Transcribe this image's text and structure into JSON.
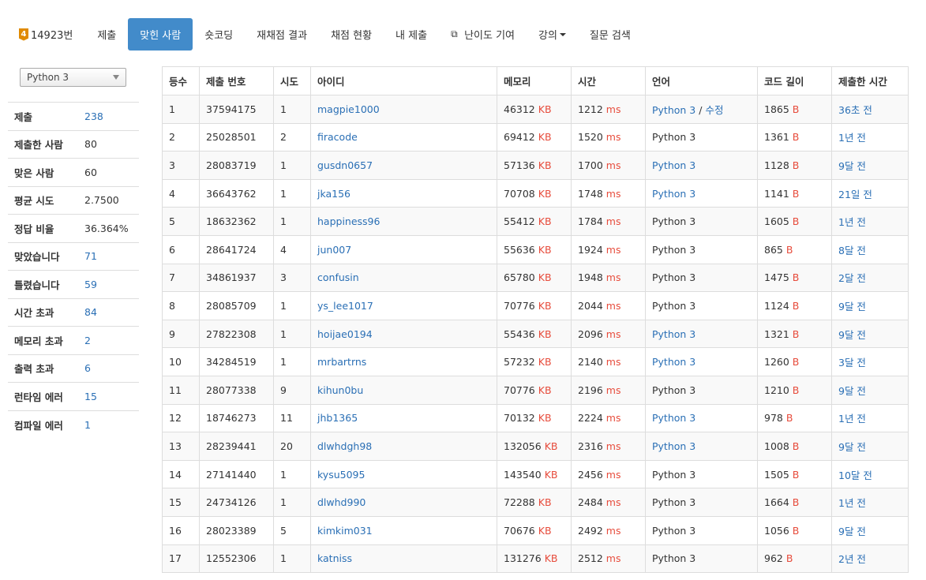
{
  "nav": {
    "problem_number": "14923번",
    "tier_badge": "4",
    "items": [
      {
        "label": "제출"
      },
      {
        "label": "맞힌 사람",
        "active": true
      },
      {
        "label": "숏코딩"
      },
      {
        "label": "재채점 결과"
      },
      {
        "label": "채점 현황"
      },
      {
        "label": "내 제출"
      },
      {
        "label": "난이도 기여",
        "icon": "external-link-icon"
      },
      {
        "label": "강의",
        "icon": "caret-down-icon"
      },
      {
        "label": "질문 검색"
      }
    ]
  },
  "sidebar": {
    "language_select": "Python 3",
    "stats": [
      {
        "label": "제출",
        "value": "238",
        "link": true
      },
      {
        "label": "제출한 사람",
        "value": "80",
        "link": false
      },
      {
        "label": "맞은 사람",
        "value": "60",
        "link": false
      },
      {
        "label": "평균 시도",
        "value": "2.7500",
        "link": false
      },
      {
        "label": "정답 비율",
        "value": "36.364%",
        "link": false
      },
      {
        "label": "맞았습니다",
        "value": "71",
        "link": true
      },
      {
        "label": "틀렸습니다",
        "value": "59",
        "link": true
      },
      {
        "label": "시간 초과",
        "value": "84",
        "link": true
      },
      {
        "label": "메모리 초과",
        "value": "2",
        "link": true
      },
      {
        "label": "출력 초과",
        "value": "6",
        "link": true
      },
      {
        "label": "런타임 에러",
        "value": "15",
        "link": true
      },
      {
        "label": "컴파일 에러",
        "value": "1",
        "link": true
      }
    ]
  },
  "table": {
    "headers": [
      "등수",
      "제출 번호",
      "시도",
      "아이디",
      "메모리",
      "시간",
      "언어",
      "코드 길이",
      "제출한 시간"
    ],
    "units": {
      "memory": "KB",
      "time": "ms",
      "length": "B"
    },
    "rows": [
      {
        "rank": "1",
        "id": "37594175",
        "tries": "1",
        "user": "magpie1000",
        "memory": "46312",
        "time": "1212",
        "lang": "Python 3",
        "lang_link": true,
        "edit": "수정",
        "length": "1865",
        "when": "36초 전"
      },
      {
        "rank": "2",
        "id": "25028501",
        "tries": "2",
        "user": "firacode",
        "memory": "69412",
        "time": "1520",
        "lang": "Python 3",
        "lang_link": false,
        "length": "1361",
        "when": "1년 전"
      },
      {
        "rank": "3",
        "id": "28083719",
        "tries": "1",
        "user": "gusdn0657",
        "memory": "57136",
        "time": "1700",
        "lang": "Python 3",
        "lang_link": true,
        "length": "1128",
        "when": "9달 전"
      },
      {
        "rank": "4",
        "id": "36643762",
        "tries": "1",
        "user": "jka156",
        "memory": "70708",
        "time": "1748",
        "lang": "Python 3",
        "lang_link": true,
        "length": "1141",
        "when": "21일 전"
      },
      {
        "rank": "5",
        "id": "18632362",
        "tries": "1",
        "user": "happiness96",
        "memory": "55412",
        "time": "1784",
        "lang": "Python 3",
        "lang_link": false,
        "length": "1605",
        "when": "1년 전"
      },
      {
        "rank": "6",
        "id": "28641724",
        "tries": "4",
        "user": "jun007",
        "memory": "55636",
        "time": "1924",
        "lang": "Python 3",
        "lang_link": false,
        "length": "865",
        "when": "8달 전"
      },
      {
        "rank": "7",
        "id": "34861937",
        "tries": "3",
        "user": "confusin",
        "memory": "65780",
        "time": "1948",
        "lang": "Python 3",
        "lang_link": false,
        "length": "1475",
        "when": "2달 전"
      },
      {
        "rank": "8",
        "id": "28085709",
        "tries": "1",
        "user": "ys_lee1017",
        "memory": "70776",
        "time": "2044",
        "lang": "Python 3",
        "lang_link": false,
        "length": "1124",
        "when": "9달 전"
      },
      {
        "rank": "9",
        "id": "27822308",
        "tries": "1",
        "user": "hoijae0194",
        "memory": "55436",
        "time": "2096",
        "lang": "Python 3",
        "lang_link": true,
        "length": "1321",
        "when": "9달 전"
      },
      {
        "rank": "10",
        "id": "34284519",
        "tries": "1",
        "user": "mrbartrns",
        "memory": "57232",
        "time": "2140",
        "lang": "Python 3",
        "lang_link": true,
        "length": "1260",
        "when": "3달 전"
      },
      {
        "rank": "11",
        "id": "28077338",
        "tries": "9",
        "user": "kihun0bu",
        "memory": "70776",
        "time": "2196",
        "lang": "Python 3",
        "lang_link": false,
        "length": "1210",
        "when": "9달 전"
      },
      {
        "rank": "12",
        "id": "18746273",
        "tries": "11",
        "user": "jhb1365",
        "memory": "70132",
        "time": "2224",
        "lang": "Python 3",
        "lang_link": true,
        "length": "978",
        "when": "1년 전"
      },
      {
        "rank": "13",
        "id": "28239441",
        "tries": "20",
        "user": "dlwhdgh98",
        "memory": "132056",
        "time": "2316",
        "lang": "Python 3",
        "lang_link": true,
        "length": "1008",
        "when": "9달 전"
      },
      {
        "rank": "14",
        "id": "27141440",
        "tries": "1",
        "user": "kysu5095",
        "memory": "143540",
        "time": "2456",
        "lang": "Python 3",
        "lang_link": false,
        "length": "1505",
        "when": "10달 전"
      },
      {
        "rank": "15",
        "id": "24734126",
        "tries": "1",
        "user": "dlwhd990",
        "memory": "72288",
        "time": "2484",
        "lang": "Python 3",
        "lang_link": false,
        "length": "1664",
        "when": "1년 전"
      },
      {
        "rank": "16",
        "id": "28023389",
        "tries": "5",
        "user": "kimkim031",
        "memory": "70676",
        "time": "2492",
        "lang": "Python 3",
        "lang_link": false,
        "length": "1056",
        "when": "9달 전"
      },
      {
        "rank": "17",
        "id": "12552306",
        "tries": "1",
        "user": "katniss",
        "memory": "131276",
        "time": "2512",
        "lang": "Python 3",
        "lang_link": false,
        "length": "962",
        "when": "2년 전"
      }
    ]
  }
}
